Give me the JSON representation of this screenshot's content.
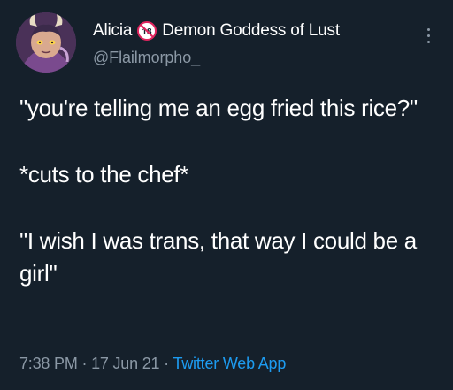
{
  "author": {
    "display_name": "Alicia",
    "badge_text": "18",
    "name_suffix": "Demon Goddess of Lust",
    "handle": "@Flailmorpho_",
    "avatar_icon": "avatar-image"
  },
  "tweet": {
    "paragraphs": [
      "\"you're telling me an egg fried this rice?\"",
      "*cuts to the chef*",
      "\"I wish I was trans, that way I could be a girl\""
    ],
    "time": "7:38 PM",
    "separator": "·",
    "date": "17 Jun 21",
    "source": "Twitter Web App"
  },
  "colors": {
    "background": "#15202b",
    "text": "#ffffff",
    "muted": "#8b98a5",
    "link": "#1d9bf0",
    "badge_red": "#e0245e"
  },
  "icons": {
    "badge": "no-under-18-icon",
    "more": "more-options-icon"
  }
}
